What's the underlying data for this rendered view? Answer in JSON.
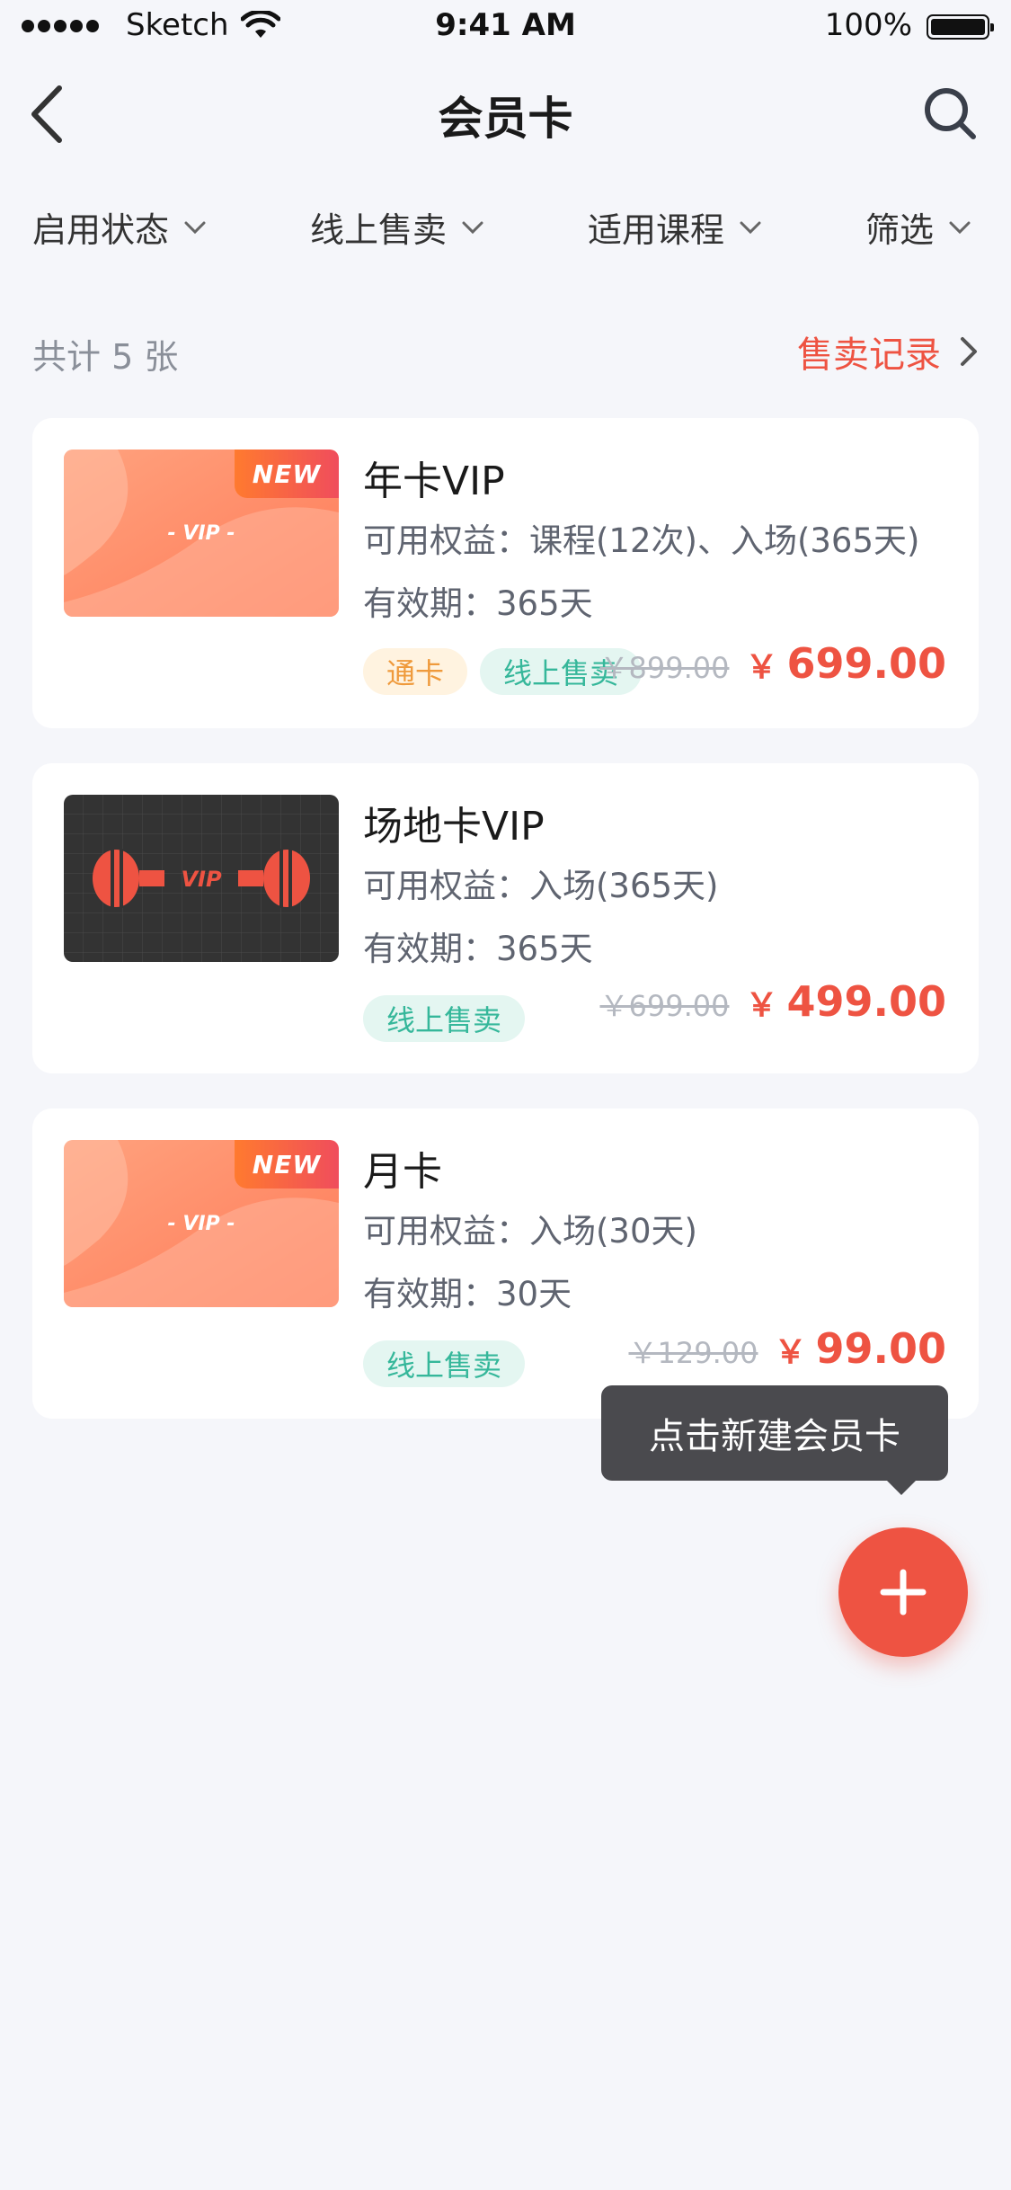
{
  "status_bar": {
    "carrier": "Sketch",
    "time": "9:41 AM",
    "battery": "100%"
  },
  "nav": {
    "title": "会员卡",
    "back_icon": "chevron-left-icon",
    "search_icon": "search-icon"
  },
  "filters": [
    {
      "label": "启用状态"
    },
    {
      "label": "线上售卖"
    },
    {
      "label": "适用课程"
    },
    {
      "label": "筛选"
    }
  ],
  "summary": {
    "count_text": "共计 5 张",
    "sales_record_label": "售卖记录"
  },
  "cards": [
    {
      "name": "年卡VIP",
      "benefits": "可用权益：课程(12次)、入场(365天)",
      "validity": "有效期：365天",
      "badge": "NEW",
      "thumb_text": "- VIP -",
      "tags": [
        "通卡",
        "线上售卖"
      ],
      "original_price": "￥899.00",
      "currency": "￥",
      "price": "699.00"
    },
    {
      "name": "场地卡VIP",
      "benefits": "可用权益：入场(365天)",
      "validity": "有效期：365天",
      "thumb_text": "VIP",
      "tags": [
        "线上售卖"
      ],
      "original_price": "￥699.00",
      "currency": "￥",
      "price": "499.00"
    },
    {
      "name": "月卡",
      "benefits": "可用权益：入场(30天)",
      "validity": "有效期：30天",
      "badge": "NEW",
      "thumb_text": "- VIP -",
      "tags": [
        "线上售卖"
      ],
      "original_price": "￥129.00",
      "currency": "￥",
      "price": "99.00"
    }
  ],
  "tooltip": {
    "text": "点击新建会员卡"
  },
  "fab": {
    "icon": "plus-icon"
  },
  "colors": {
    "accent": "#ee5342",
    "background": "#f5f6fa",
    "tag_green_text": "#35b79a",
    "tag_orange_text": "#ef9a3c"
  }
}
